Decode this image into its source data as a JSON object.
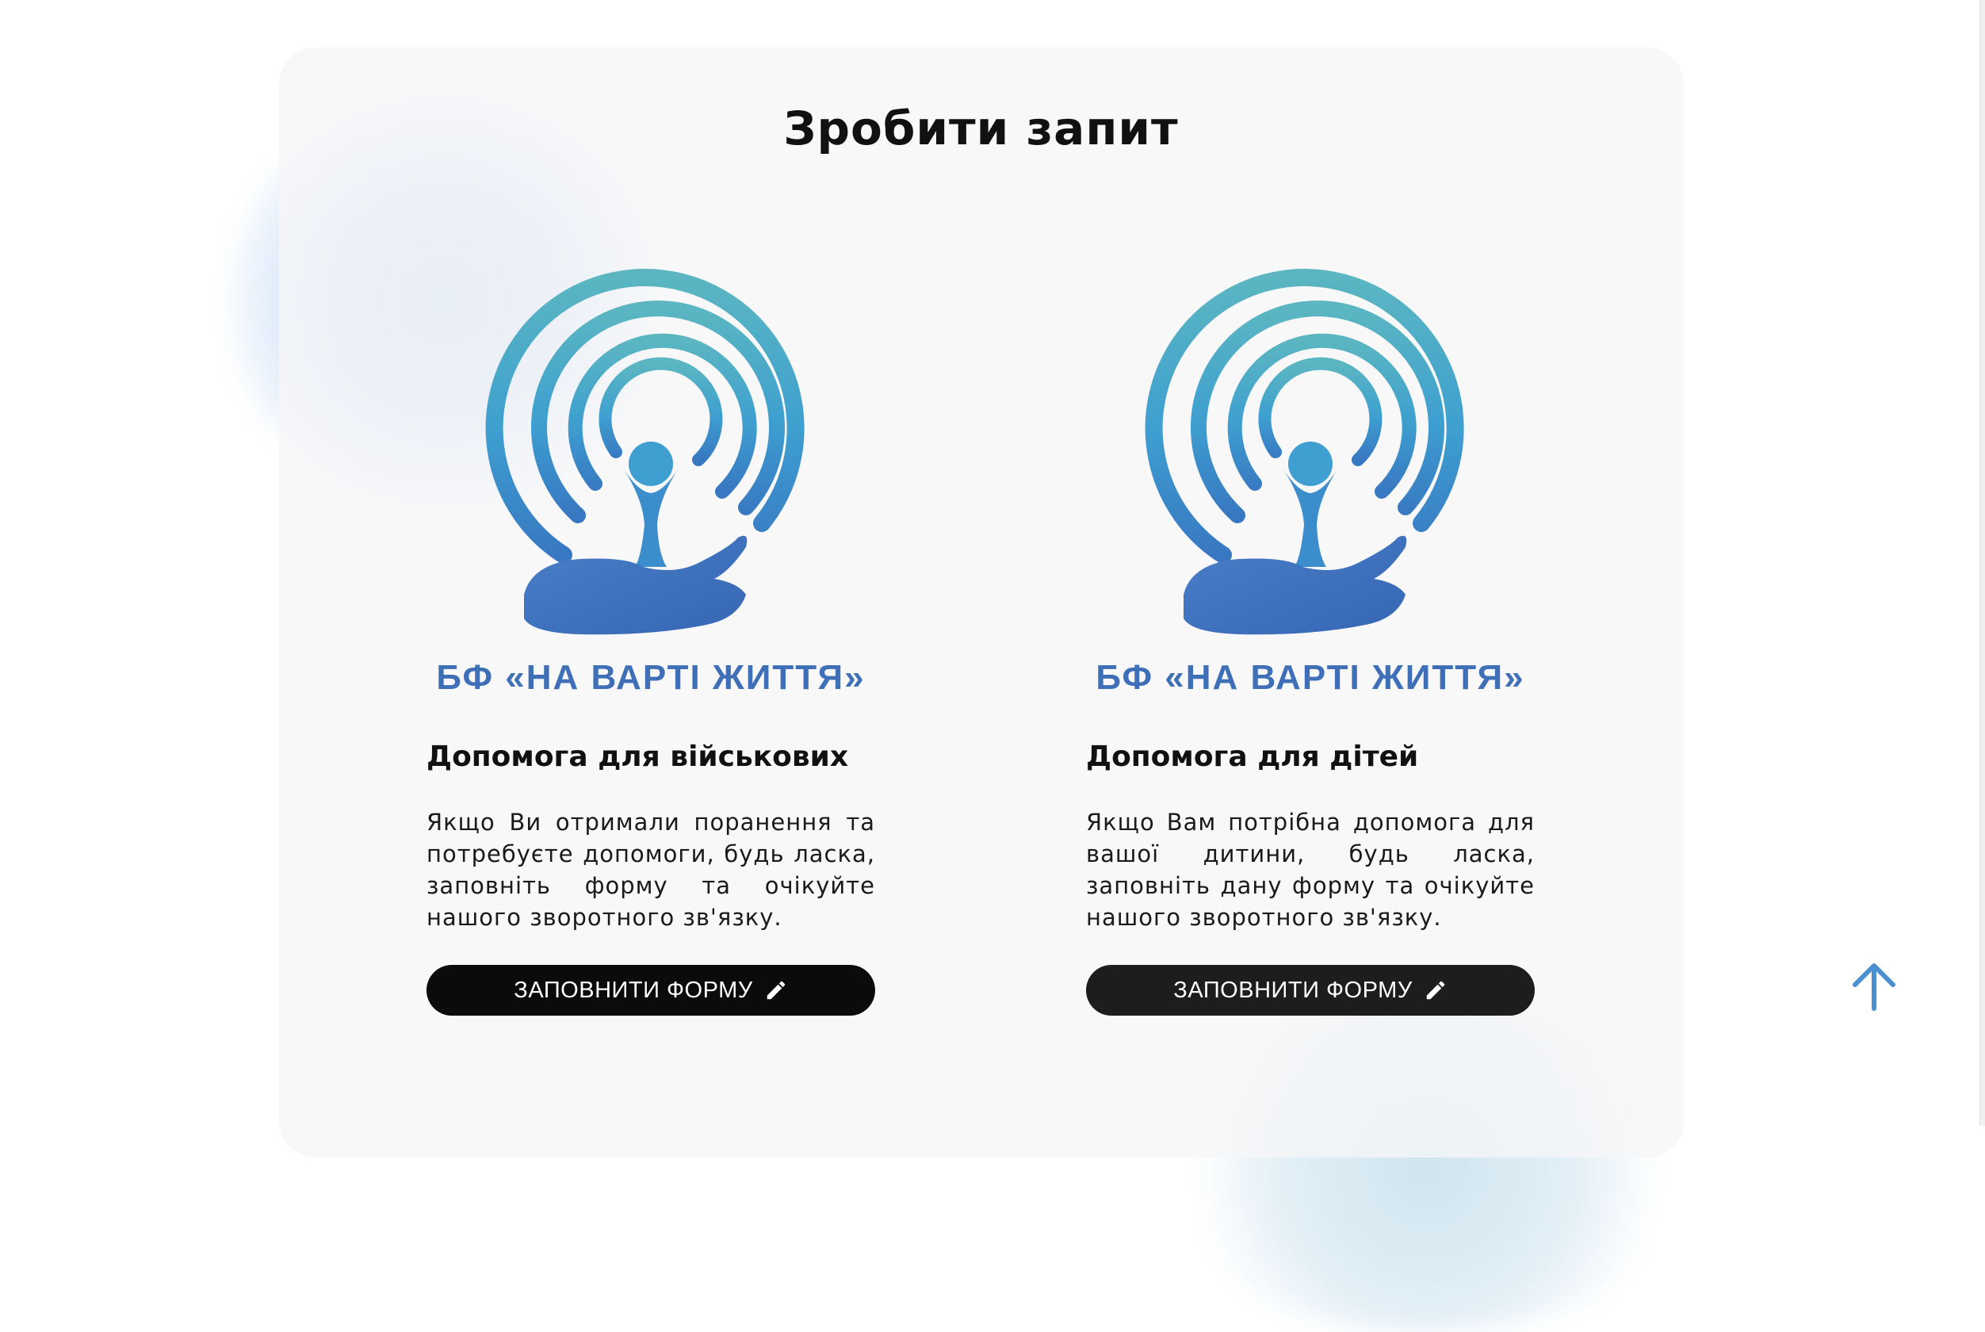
{
  "section": {
    "title": "Зробити запит"
  },
  "cards": [
    {
      "brand": "БФ «НА ВАРТІ ЖИТТЯ»",
      "title": "Допомога для військових",
      "text": "Якщо Ви отримали поранення та потребуєте допомоги, будь ласка, заповніть форму та очікуйте нашого зворотного зв'язку.",
      "button_label": "ЗАПОВНИТИ ФОРМУ"
    },
    {
      "brand": "БФ «НА ВАРТІ ЖИТТЯ»",
      "title": "Допомога для дітей",
      "text": "Якщо Вам потрібна допомога для вашої дитини, будь ласка, заповніть дану форму та очікуйте нашого зворотного зв'язку.",
      "button_label": "ЗАПОВНИТИ ФОРМУ"
    }
  ],
  "icons": {
    "logo": "charity-logo-icon",
    "button": "pencil-icon",
    "scroll": "arrow-up-icon"
  },
  "colors": {
    "brand_blue": "#3f6fb7",
    "teal": "#5bb6c1",
    "button_bg": "#0b0b0b",
    "arrow": "#4a90d0"
  }
}
